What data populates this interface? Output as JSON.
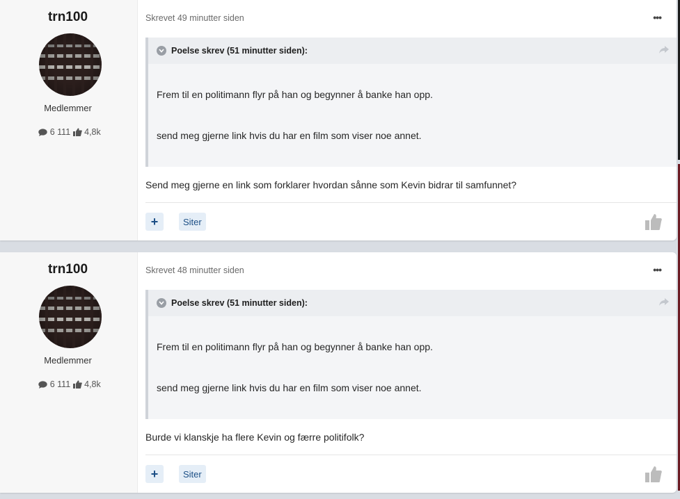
{
  "posts": [
    {
      "author": "trn100",
      "rank": "Medlemmer",
      "stats": {
        "posts": "6 111",
        "reputation": "4,8k"
      },
      "meta": "Skrevet 49 minutter siden",
      "quote": {
        "header": "Poelse skrev (51 minutter siden):",
        "lines": [
          "Frem til en politimann flyr på han og begynner å banke han opp.",
          "send meg gjerne link hvis du har en film som viser noe annet."
        ]
      },
      "text": "Send meg gjerne en link som forklarer hvordan sånne som Kevin bidrar til samfunnet?",
      "actions": {
        "plus": "+",
        "quote": "Siter"
      }
    },
    {
      "author": "trn100",
      "rank": "Medlemmer",
      "stats": {
        "posts": "6 111",
        "reputation": "4,8k"
      },
      "meta": "Skrevet 48 minutter siden",
      "quote": {
        "header": "Poelse skrev (51 minutter siden):",
        "lines": [
          "Frem til en politimann flyr på han og begynner å banke han opp.",
          "send meg gjerne link hvis du har en film som viser noe annet."
        ]
      },
      "text": "Burde vi klanskje ha flere Kevin og færre politifolk?",
      "actions": {
        "plus": "+",
        "quote": "Siter"
      }
    }
  ],
  "icons": {
    "more": "ellipsis-icon",
    "expand": "chevron-down-icon",
    "share": "share-icon",
    "comments": "comment-icon",
    "reputation": "thumbs-up-icon",
    "like": "like-icon"
  },
  "colors": {
    "link": "#1c4f86",
    "button_bg": "#e5eef7",
    "quote_bg": "#f4f5f7",
    "author_bg": "#f7f7f7",
    "page_bg": "#d9dde3"
  }
}
